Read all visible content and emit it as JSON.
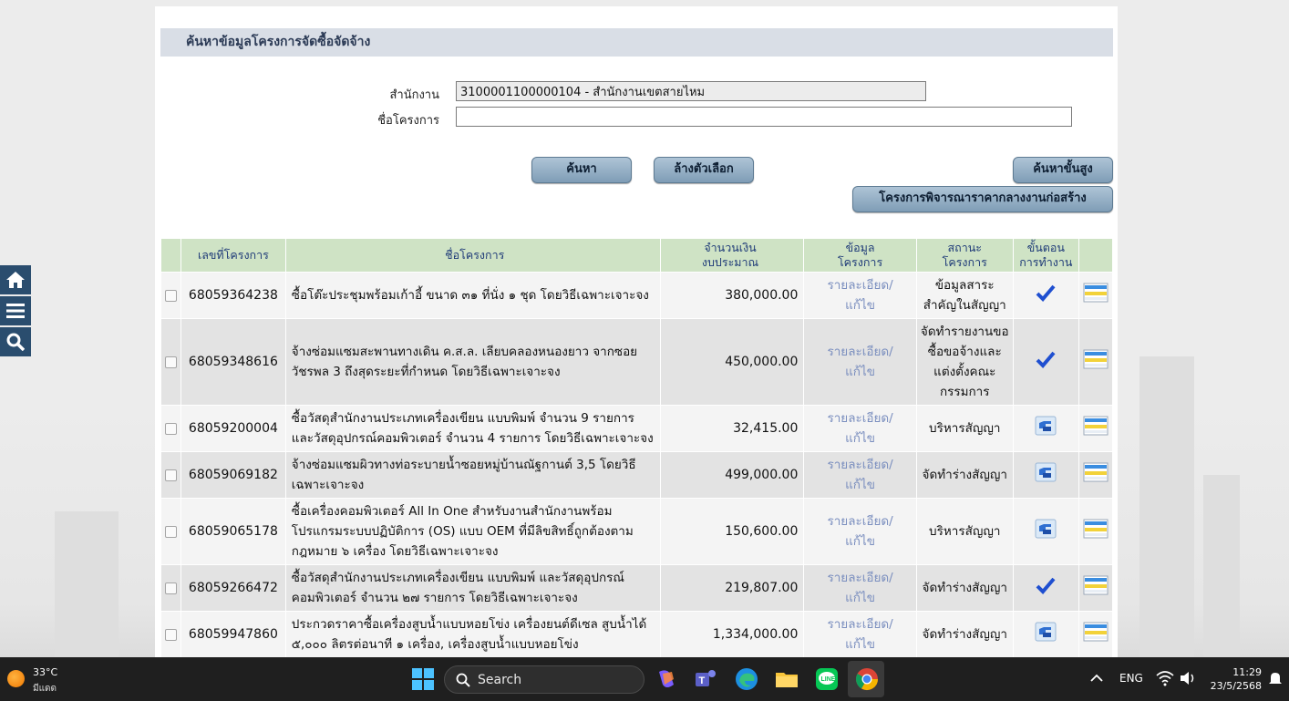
{
  "page": {
    "title": "ค้นหาข้อมูลโครงการจัดซื้อจัดจ้าง"
  },
  "form": {
    "office_label": "สำนักงาน",
    "office_value": "3100001100000104 - สำนักงานเขตสายไหม",
    "project_label": "ชื่อโครงการ",
    "project_value": ""
  },
  "buttons": {
    "search": "ค้นหา",
    "clear": "ล้างตัวเลือก",
    "advanced": "ค้นหาขั้นสูง",
    "median_price": "โครงการพิจารณาราคากลางงานก่อสร้าง"
  },
  "table": {
    "headers": {
      "project_no": "เลขที่โครงการ",
      "project_name": "ชื่อโครงการ",
      "amount_line1": "จำนวนเงิน",
      "amount_line2": "งบประมาณ",
      "info_line1": "ข้อมูล",
      "info_line2": "โครงการ",
      "status_line1": "สถานะ",
      "status_line2": "โครงการ",
      "step_line1": "ขั้นตอน",
      "step_line2": "การทำงาน"
    },
    "rows": [
      {
        "no": "68059364238",
        "name": "ซื้อโต๊ะประชุมพร้อมเก้าอี้ ขนาด ๓๑ ที่นั่ง ๑ ชุด โดยวิธีเฉพาะเจาะจง",
        "amount": "380,000.00",
        "info_line1": "รายละเอียด/",
        "info_line2": "แก้ไข",
        "status": "ข้อมูลสาระสำคัญในสัญญา",
        "step_icon": "check-icon"
      },
      {
        "no": "68059348616",
        "name": "จ้างซ่อมแซมสะพานทางเดิน ค.ส.ล. เลียบคลองหนองยาว จากซอยวัชรพล 3 ถึงสุดระยะที่กำหนด โดยวิธีเฉพาะเจาะจง",
        "amount": "450,000.00",
        "info_line1": "รายละเอียด/",
        "info_line2": "แก้ไข",
        "status": "จัดทำรายงานขอซื้อขอจ้างและแต่งตั้งคณะกรรมการ",
        "step_icon": "check-icon"
      },
      {
        "no": "68059200004",
        "name": "ซื้อวัสดุสำนักงานประเภทเครื่องเขียน แบบพิมพ์ จำนวน 9 รายการ และวัสดุอุปกรณ์คอมพิวเตอร์ จำนวน 4 รายการ โดยวิธีเฉพาะเจาะจง",
        "amount": "32,415.00",
        "info_line1": "รายละเอียด/",
        "info_line2": "แก้ไข",
        "status": "บริหารสัญญา",
        "step_icon": "hand-icon"
      },
      {
        "no": "68059069182",
        "name": "จ้างซ่อมแซมผิวทางท่อระบายน้ำซอยหมู่บ้านณัฐกานต์ 3,5 โดยวิธีเฉพาะเจาะจง",
        "amount": "499,000.00",
        "info_line1": "รายละเอียด/",
        "info_line2": "แก้ไข",
        "status": "จัดทำร่างสัญญา",
        "step_icon": "hand-icon"
      },
      {
        "no": "68059065178",
        "name": "ซื้อเครื่องคอมพิวเตอร์ All In One สำหรับงานสำนักงานพร้อมโปรแกรมระบบปฏิบัติการ (OS) แบบ OEM ที่มีลิขสิทธิ์ถูกต้องตามกฎหมาย ๖ เครื่อง โดยวิธีเฉพาะเจาะจง",
        "amount": "150,600.00",
        "info_line1": "รายละเอียด/",
        "info_line2": "แก้ไข",
        "status": "บริหารสัญญา",
        "step_icon": "hand-icon"
      },
      {
        "no": "68059266472",
        "name": "ซื้อวัสดุสำนักงานประเภทเครื่องเขียน แบบพิมพ์ และวัสดุอุปกรณ์คอมพิวเตอร์ จำนวน ๒๗ รายการ โดยวิธีเฉพาะเจาะจง",
        "amount": "219,807.00",
        "info_line1": "รายละเอียด/",
        "info_line2": "แก้ไข",
        "status": "จัดทำร่างสัญญา",
        "step_icon": "check-icon"
      },
      {
        "no": "68059947860",
        "name": "ประกวดราคาซื้อเครื่องสูบน้ำแบบหอยโข่ง เครื่องยนต์ดีเซล สูบน้ำได้ ๕,๐๐๐ ลิตรต่อนาที ๑ เครื่อง, เครื่องสูบน้ำแบบหอยโข่ง",
        "amount": "1,334,000.00",
        "info_line1": "รายละเอียด/",
        "info_line2": "แก้ไข",
        "status": "จัดทำร่างสัญญา",
        "step_icon": "hand-icon"
      }
    ]
  },
  "taskbar": {
    "temperature": "33°C",
    "condition": "มีแดด",
    "search_label": "Search",
    "language": "ENG",
    "time": "11:29",
    "date": "23/5/2568"
  }
}
